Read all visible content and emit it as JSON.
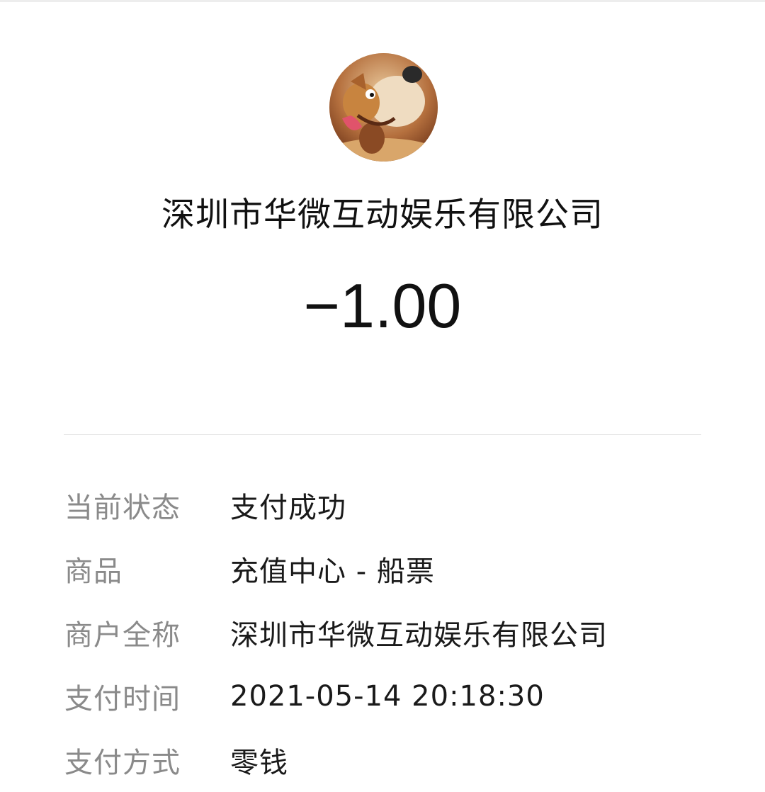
{
  "merchant": {
    "avatar_icon": "cartoon-dog-avatar",
    "name": "深圳市华微互动娱乐有限公司"
  },
  "amount": "−1.00",
  "details": [
    {
      "label": "当前状态",
      "value": "支付成功"
    },
    {
      "label": "商品",
      "value": "充值中心 - 船票"
    },
    {
      "label": "商户全称",
      "value": "深圳市华微互动娱乐有限公司"
    },
    {
      "label": "支付时间",
      "value": "2021-05-14 20:18:30"
    },
    {
      "label": "支付方式",
      "value": "零钱"
    }
  ],
  "colors": {
    "label": "#8a8a8a",
    "value": "#1a1a1a",
    "divider": "#e5e5e5"
  }
}
